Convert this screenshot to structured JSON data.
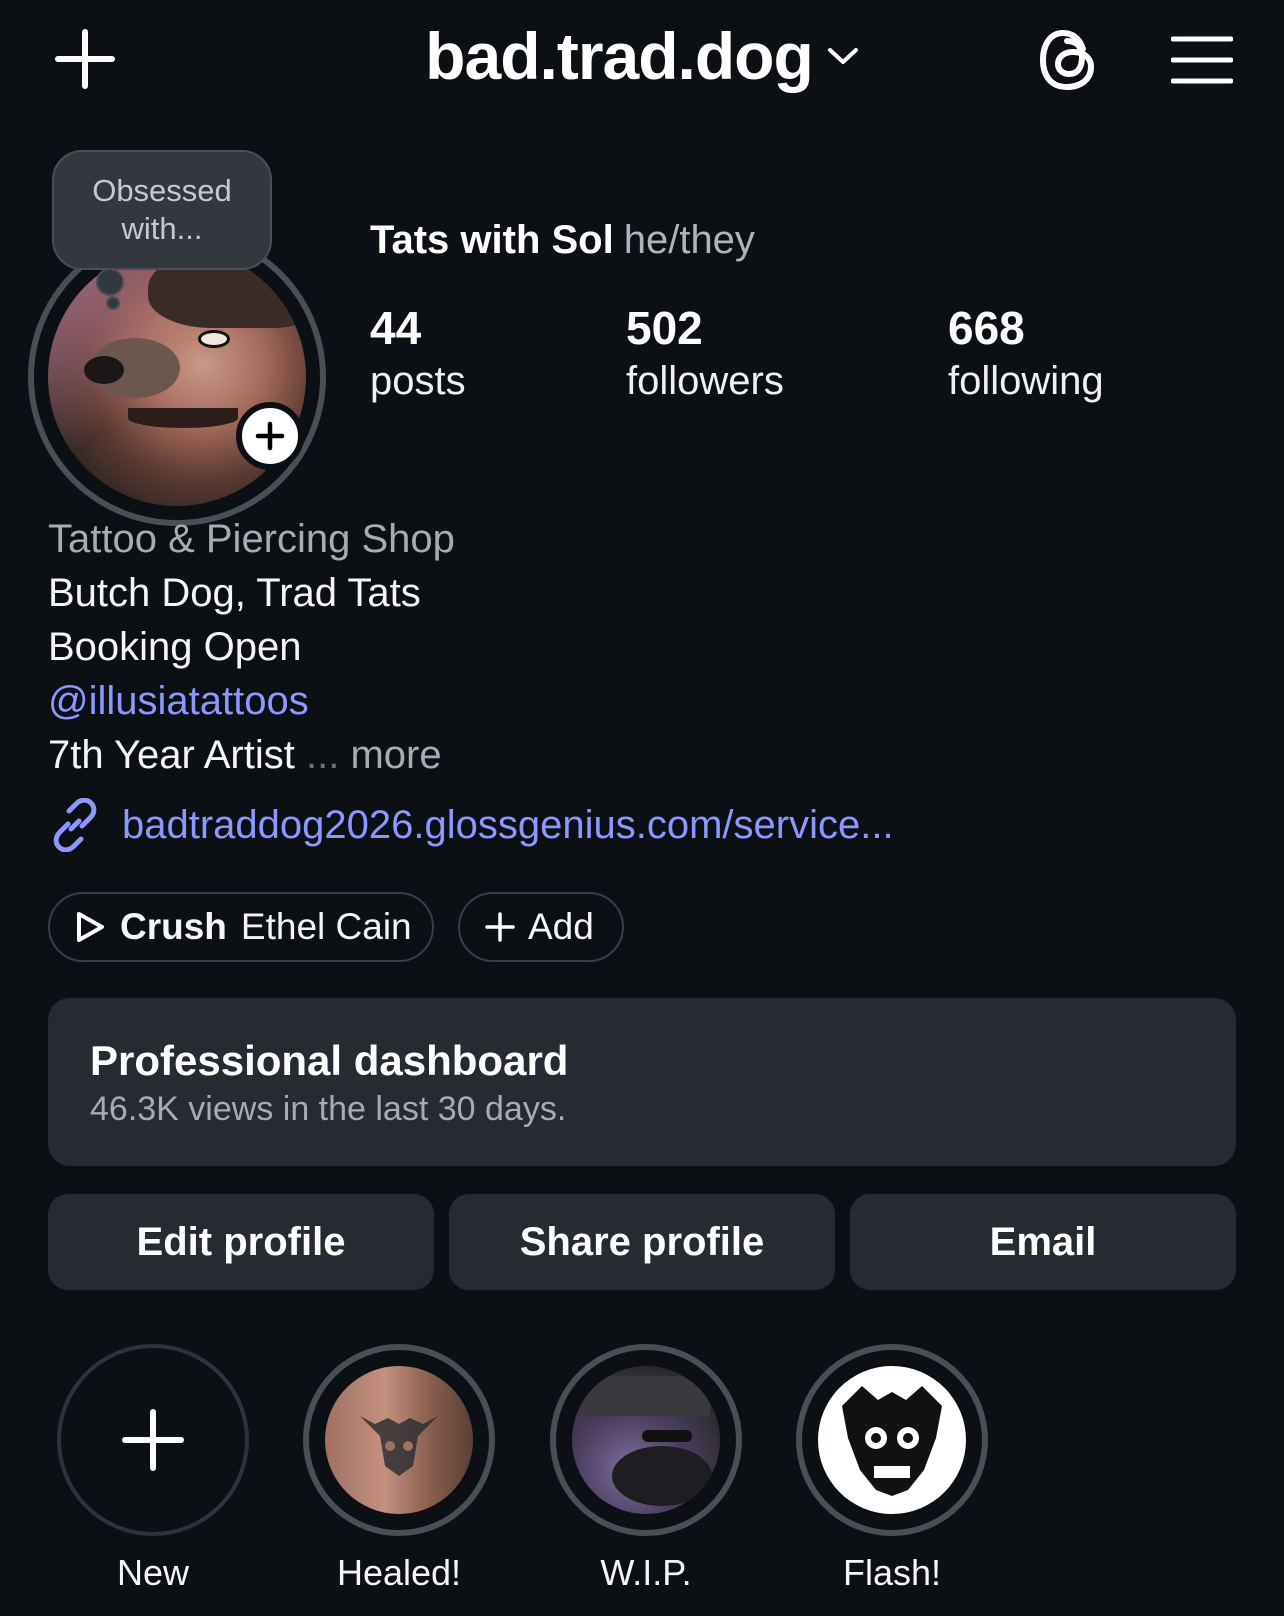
{
  "header": {
    "username": "bad.trad.dog",
    "icons": [
      "plus-icon",
      "chevron-down-icon",
      "threads-icon",
      "hamburger-menu-icon"
    ]
  },
  "note": {
    "text": "Obsessed with..."
  },
  "profile": {
    "display_name": "Tats with Sol",
    "pronouns": "he/they"
  },
  "stats": [
    {
      "value": "44",
      "label": "posts"
    },
    {
      "value": "502",
      "label": "followers"
    },
    {
      "value": "668",
      "label": "following"
    }
  ],
  "bio": {
    "category": "Tattoo & Piercing Shop",
    "line1": "Butch Dog, Trad Tats",
    "line2": "Booking Open",
    "mention": "@illusiatattoos",
    "line3": "7th Year Artist",
    "ellipsis": "...",
    "more": "more",
    "link": "badtraddog2026.glossgenius.com/service..."
  },
  "music": {
    "song": "Crush",
    "artist": "Ethel Cain",
    "add_label": "Add"
  },
  "dashboard": {
    "title": "Professional dashboard",
    "subtitle": "46.3K views in the last 30 days."
  },
  "actions": {
    "edit": "Edit profile",
    "share": "Share profile",
    "email": "Email"
  },
  "highlights": [
    {
      "label": "New"
    },
    {
      "label": "Healed!"
    },
    {
      "label": "W.I.P."
    },
    {
      "label": "Flash!"
    }
  ],
  "colors": {
    "background": "#0c0f14",
    "card": "#262a31",
    "link": "#8c98ff",
    "muted": "#a8abb0"
  }
}
